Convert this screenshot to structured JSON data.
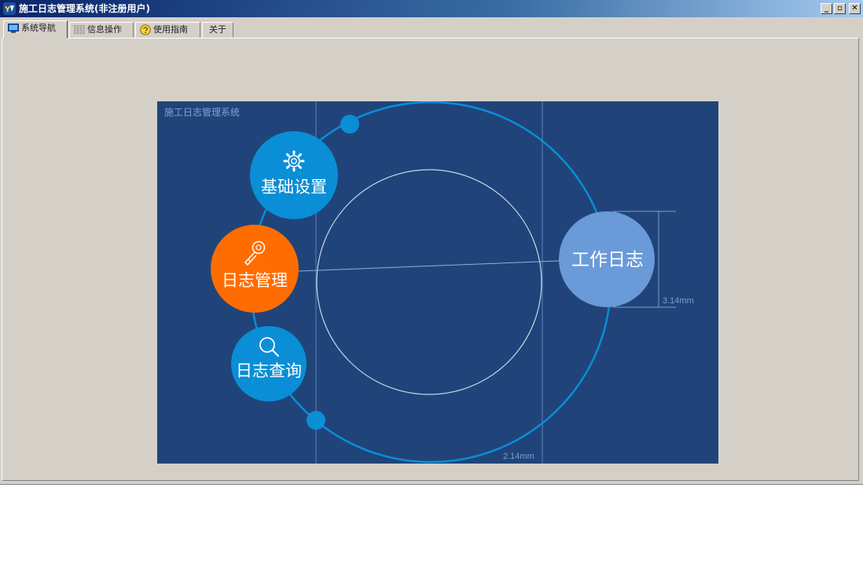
{
  "window": {
    "title": "施工日志管理系统(非注册用户)"
  },
  "window_controls": {
    "minimize": "_",
    "restore": "▫",
    "close": "✕"
  },
  "tabs": [
    {
      "label": "系统导航",
      "icon": "monitor-icon"
    },
    {
      "label": "信息操作",
      "icon": "grid-icon"
    },
    {
      "label": "使用指南",
      "icon": "guide-icon"
    },
    {
      "label": "关于",
      "icon": ""
    }
  ],
  "panel": {
    "title": "施工日志管理系统",
    "menu": [
      {
        "label": "基础设置",
        "icon": "gear-icon",
        "color": "#0a8ed6"
      },
      {
        "label": "日志管理",
        "icon": "key-icon",
        "color": "#ff6d00"
      },
      {
        "label": "日志查询",
        "icon": "search-icon",
        "color": "#0a8ed6"
      }
    ],
    "main_button": {
      "label": "工作日志",
      "color": "#6a9ad8"
    },
    "dim_vertical": "3.14mm",
    "dim_horizontal": "2.14mm",
    "colors": {
      "background": "#20447a",
      "ring": "#0a8ed6",
      "line": "#5a82b8"
    }
  }
}
